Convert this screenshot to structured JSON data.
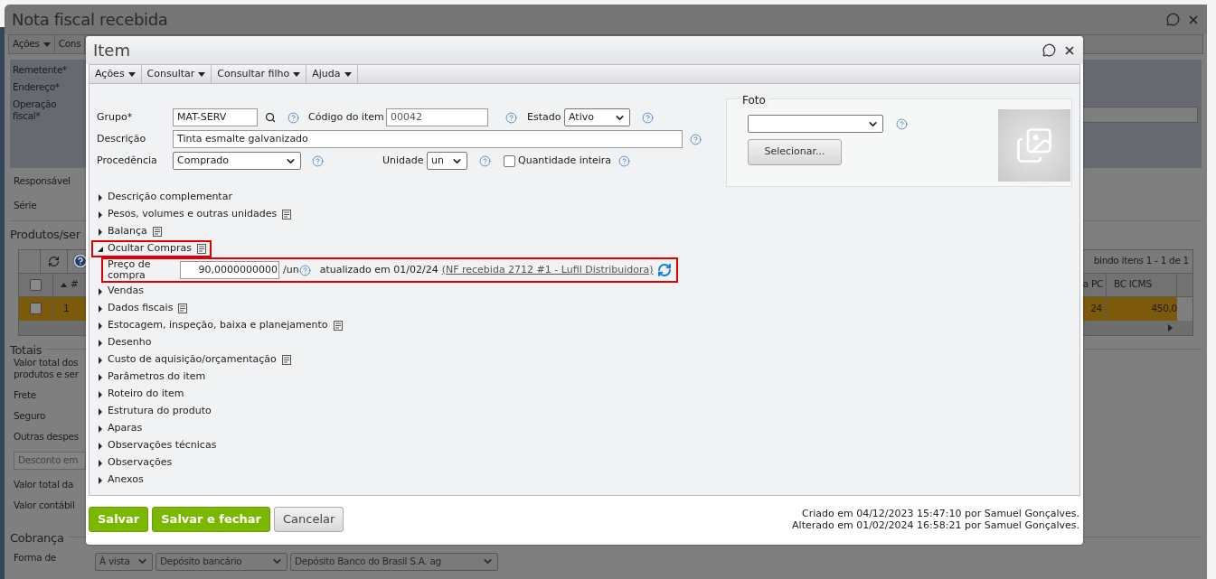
{
  "background_window": {
    "title": "Nota fiscal recebida",
    "menu": [
      "Ações",
      "Cons"
    ],
    "header_fields": [
      "Remetente*",
      "Endereço*",
      "Operação fiscal*"
    ],
    "fields": [
      "Responsável",
      "Série"
    ],
    "products": {
      "title": "Produtos/ser",
      "pager": "bindo itens 1 - 1 de 1",
      "all_checked": false,
      "columns": [
        {
          "label": "#",
          "sorted": true
        },
        {
          "label": "a PC"
        },
        {
          "label": "BC ICMS"
        }
      ],
      "rows": [
        {
          "selected": true,
          "checked": false,
          "cells": [
            "1",
            "24",
            "450,0"
          ]
        }
      ]
    },
    "totals": {
      "title": "Totais",
      "fields": [
        "Valor total dos produtos e ser",
        "Frete",
        "Seguro",
        "Outras despes"
      ],
      "discount_placeholder": "Desconto em",
      "fields_after": [
        "Valor total da",
        "Valor contábil"
      ]
    },
    "billing": {
      "title": "Cobrança",
      "label": "Forma de",
      "selects": [
        "À vista",
        "Depósito bancário",
        "Depósito Banco do Brasil S.A. ag"
      ]
    }
  },
  "dialog": {
    "title": "Item",
    "menu": [
      "Ações",
      "Consultar",
      "Consultar filho",
      "Ajuda"
    ],
    "group": {
      "label": "Grupo*",
      "value": "MAT-SERV"
    },
    "code": {
      "label": "Código do item",
      "value": "00042"
    },
    "state": {
      "label": "Estado",
      "value": "Ativo"
    },
    "description": {
      "label": "Descrição",
      "value": "Tinta esmalte galvanizado"
    },
    "origin": {
      "label": "Procedência",
      "value": "Comprado"
    },
    "unit": {
      "label": "Unidade",
      "value": "un"
    },
    "whole_quantity": {
      "label": "Quantidade inteira",
      "checked": false
    },
    "photo": {
      "legend": "Foto",
      "button": "Selecionar..."
    },
    "sections": [
      {
        "label": "Descrição complementar",
        "expanded": false,
        "notes": false,
        "highlighted": false
      },
      {
        "label": "Pesos, volumes e outras unidades",
        "expanded": false,
        "notes": true,
        "highlighted": false
      },
      {
        "label": "Balança",
        "expanded": false,
        "notes": true,
        "highlighted": false
      },
      {
        "label": "Ocultar Compras",
        "expanded": true,
        "notes": true,
        "highlighted": true,
        "detail": {
          "label": "Preço de compra",
          "value": "90,0000000000",
          "unit": "/un",
          "updated": "atualizado em 01/02/24",
          "link": "(NF recebida 2712 #1 - Lufil Distribuidora)",
          "highlighted": true
        }
      },
      {
        "label": "Vendas",
        "expanded": false,
        "notes": false,
        "highlighted": false
      },
      {
        "label": "Dados fiscais",
        "expanded": false,
        "notes": true,
        "highlighted": false
      },
      {
        "label": "Estocagem, inspeção, baixa e planejamento",
        "expanded": false,
        "notes": true,
        "highlighted": false
      },
      {
        "label": "Desenho",
        "expanded": false,
        "notes": false,
        "highlighted": false
      },
      {
        "label": "Custo de aquisição/orçamentação",
        "expanded": false,
        "notes": true,
        "highlighted": false
      },
      {
        "label": "Parâmetros do item",
        "expanded": false,
        "notes": false,
        "highlighted": false
      },
      {
        "label": "Roteiro do item",
        "expanded": false,
        "notes": false,
        "highlighted": false
      },
      {
        "label": "Estrutura do produto",
        "expanded": false,
        "notes": false,
        "highlighted": false
      },
      {
        "label": "Aparas",
        "expanded": false,
        "notes": false,
        "highlighted": false
      },
      {
        "label": "Observações técnicas",
        "expanded": false,
        "notes": false,
        "highlighted": false
      },
      {
        "label": "Observações",
        "expanded": false,
        "notes": false,
        "highlighted": false
      },
      {
        "label": "Anexos",
        "expanded": false,
        "notes": false,
        "highlighted": false
      }
    ],
    "buttons": [
      {
        "label": "Salvar",
        "kind": "primary"
      },
      {
        "label": "Salvar e fechar",
        "kind": "primary"
      },
      {
        "label": "Cancelar",
        "kind": "secondary"
      }
    ],
    "audit": [
      "Criado em 04/12/2023 15:47:10 por Samuel Gonçalves.",
      "Alterado em 01/02/2024 16:58:21 por Samuel Gonçalves."
    ]
  }
}
